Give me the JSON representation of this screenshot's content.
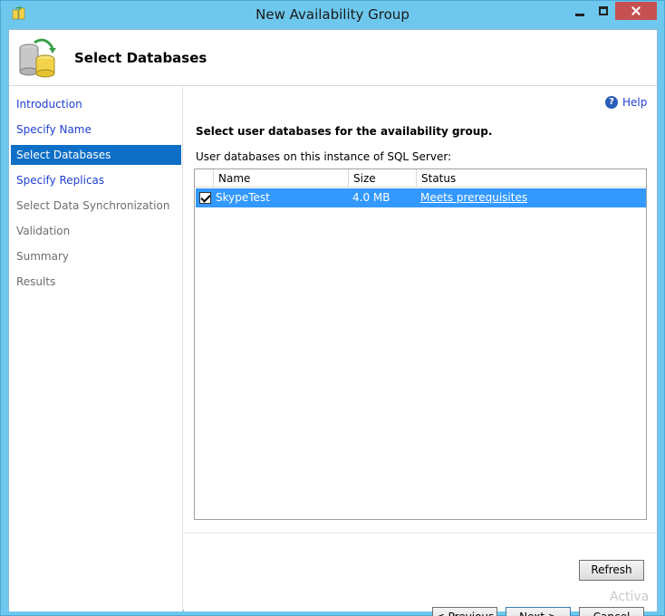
{
  "window": {
    "title": "New Availability Group"
  },
  "header": {
    "title": "Select Databases"
  },
  "sidebar": {
    "items": [
      {
        "label": "Introduction",
        "state": "link"
      },
      {
        "label": "Specify Name",
        "state": "link"
      },
      {
        "label": "Select Databases",
        "state": "selected"
      },
      {
        "label": "Specify Replicas",
        "state": "link"
      },
      {
        "label": "Select Data Synchronization",
        "state": "disabled"
      },
      {
        "label": "Validation",
        "state": "disabled"
      },
      {
        "label": "Summary",
        "state": "disabled"
      },
      {
        "label": "Results",
        "state": "disabled"
      }
    ]
  },
  "content": {
    "help_label": "Help",
    "section_title": "Select user databases for the availability group.",
    "list_label": "User databases on this instance of SQL Server:",
    "table": {
      "headers": [
        "",
        "Name",
        "Size",
        "Status"
      ],
      "rows": [
        {
          "checked": true,
          "name": "SkypeTest",
          "size": "4.0 MB",
          "status": "Meets prerequisites"
        }
      ]
    },
    "refresh_label": "Refresh"
  },
  "footer": {
    "previous_label": "< Previous",
    "next_label": "Next >",
    "cancel_label": "Cancel"
  },
  "watermark": "Activa",
  "colors": {
    "selection": "#3399ff",
    "nav_selected": "#0e6fc7",
    "link": "#1f3fd0",
    "titlebar": "#6ec8ee"
  }
}
